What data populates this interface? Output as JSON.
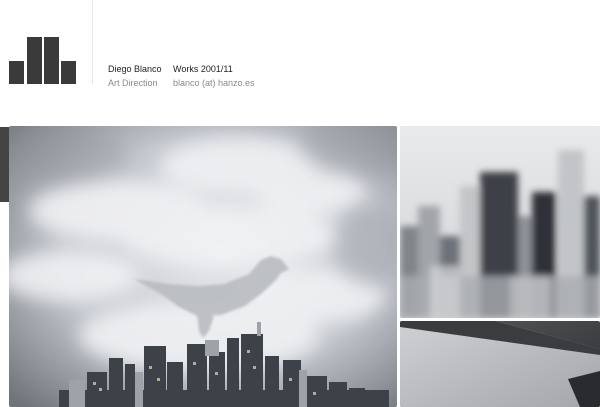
{
  "header": {
    "name": "Diego Blanco",
    "role": "Art Direction",
    "works": "Works 2001/11",
    "email": "blanco (at) hanzo.es"
  },
  "logo": {
    "icon": "bar-graph-logo-icon",
    "color": "#3a3a3a"
  },
  "gallery": {
    "main_image": "surreal-bird-over-city-image",
    "thumbnails": [
      "blurred-skyline-image",
      "dark-rooftop-image"
    ]
  }
}
